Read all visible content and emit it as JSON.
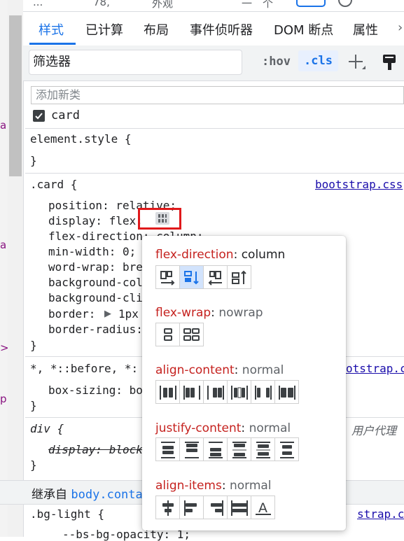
{
  "top_strip": [
    "...",
    "78,",
    "外观",
    "一",
    "个"
  ],
  "tabs": [
    {
      "label": "样式",
      "active": true
    },
    {
      "label": "已计算",
      "active": false
    },
    {
      "label": "布局",
      "active": false
    },
    {
      "label": "事件侦听器",
      "active": false
    },
    {
      "label": "DOM 断点",
      "active": false
    },
    {
      "label": "属性",
      "active": false
    }
  ],
  "filter": {
    "placeholder": "筛选器",
    "hov": ":hov",
    "cls": ".cls"
  },
  "add_class_placeholder": "添加新类",
  "class_checkbox": {
    "label": "card",
    "checked": true
  },
  "gutter_marks": [
    "a",
    "a",
    ">",
    "p"
  ],
  "rules": {
    "element_style": {
      "open": "element.style {",
      "close": "}"
    },
    "card": {
      "selector": ".card {",
      "source": "bootstrap.css",
      "props": [
        "position: relative;",
        "display: flex;",
        "flex-direction: column;",
        "min-width: 0;",
        "word-wrap: bre",
        "background-col",
        "background-cli",
        "border: ",
        "border-radius:"
      ],
      "border_value": "1px",
      "close": "}"
    },
    "universal": {
      "selector": "*, *::before, *:",
      "source": "otstrap.cs",
      "prop": "box-sizing: bo",
      "close": "}"
    },
    "div": {
      "selector": "div {",
      "source_label": "用户代理",
      "prop": "display: block",
      "close": "}"
    },
    "inherited": {
      "label": "继承自 ",
      "link": "body.conta"
    },
    "bg_light": {
      "selector": ".bg-light {",
      "source": "strap.css",
      "prop": "--bs-bg-opacity: 1;"
    }
  },
  "flex_popover": {
    "sections": [
      {
        "key": "flex-direction",
        "value": "column",
        "buttons": [
          "row",
          "column",
          "row-reverse",
          "column-reverse"
        ],
        "selected": 1
      },
      {
        "key": "flex-wrap",
        "value": "nowrap",
        "buttons": [
          "nowrap",
          "wrap"
        ],
        "selected": -1
      },
      {
        "key": "align-content",
        "value": "normal",
        "buttons": [
          "center",
          "flex-start",
          "flex-end",
          "space-around",
          "space-between",
          "stretch"
        ],
        "selected": -1
      },
      {
        "key": "justify-content",
        "value": "normal",
        "buttons": [
          "center",
          "flex-start",
          "flex-end",
          "space-between",
          "space-around",
          "space-evenly"
        ],
        "selected": -1
      },
      {
        "key": "align-items",
        "value": "normal",
        "buttons": [
          "center",
          "flex-start",
          "flex-end",
          "stretch",
          "baseline"
        ],
        "selected": -1
      }
    ]
  },
  "colors": {
    "accent": "#1a73e8",
    "prop_key": "#c5221f",
    "highlight_box": "#e0191b",
    "selected_btn": "#d2e3fc"
  }
}
